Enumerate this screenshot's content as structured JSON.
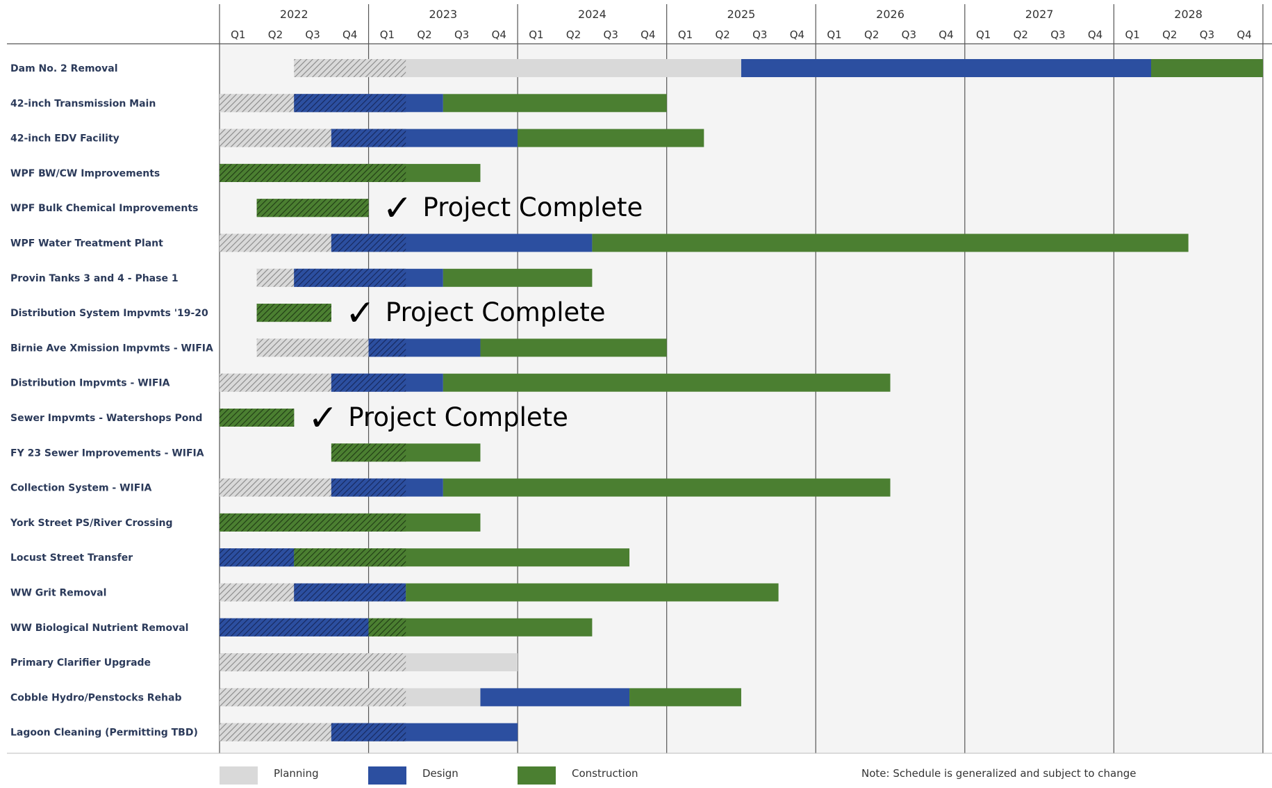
{
  "chart_data": {
    "type": "gantt",
    "years": [
      "2022",
      "2023",
      "2024",
      "2025",
      "2026",
      "2027",
      "2028"
    ],
    "quarters": [
      "Q1",
      "Q2",
      "Q3",
      "Q4"
    ],
    "phases": {
      "planning": {
        "label": "Planning",
        "color": "#d9d9d9",
        "hatch_color": "#888888"
      },
      "design": {
        "label": "Design",
        "color": "#2c4fa0",
        "hatch_color": "#16275a"
      },
      "construction": {
        "label": "Construction",
        "color": "#4b7f31",
        "hatch_color": "#1f3a14"
      }
    },
    "hatch_end": "2023-Q2",
    "note": "Note: Schedule is generalized and subject to change",
    "complete_text": "Project Complete",
    "rows": [
      {
        "label": "Dam No. 2 Removal",
        "segments": [
          [
            "planning",
            "2022-Q3",
            "2025-Q3"
          ],
          [
            "design",
            "2025-Q3",
            "2028-Q2"
          ],
          [
            "construction",
            "2028-Q2",
            "2029-Q1"
          ]
        ]
      },
      {
        "label": "42-inch Transmission Main",
        "segments": [
          [
            "planning",
            "2022-Q1",
            "2022-Q3"
          ],
          [
            "design",
            "2022-Q3",
            "2023-Q3"
          ],
          [
            "construction",
            "2023-Q3",
            "2025-Q1"
          ]
        ]
      },
      {
        "label": "42-inch EDV Facility",
        "segments": [
          [
            "planning",
            "2022-Q1",
            "2022-Q4"
          ],
          [
            "design",
            "2022-Q4",
            "2024-Q1"
          ],
          [
            "construction",
            "2024-Q1",
            "2025-Q2"
          ]
        ]
      },
      {
        "label": "WPF BW/CW Improvements",
        "segments": [
          [
            "construction",
            "2022-Q1",
            "2023-Q4"
          ]
        ]
      },
      {
        "label": "WPF Bulk Chemical Improvements",
        "segments": [
          [
            "construction",
            "2022-Q2",
            "2023-Q1"
          ]
        ],
        "complete": true
      },
      {
        "label": "WPF Water Treatment Plant",
        "segments": [
          [
            "planning",
            "2022-Q1",
            "2022-Q4"
          ],
          [
            "design",
            "2022-Q4",
            "2024-Q3"
          ],
          [
            "construction",
            "2024-Q3",
            "2028-Q3"
          ]
        ]
      },
      {
        "label": "Provin Tanks 3 and 4  - Phase 1",
        "segments": [
          [
            "planning",
            "2022-Q2",
            "2022-Q3"
          ],
          [
            "design",
            "2022-Q3",
            "2023-Q3"
          ],
          [
            "construction",
            "2023-Q3",
            "2024-Q3"
          ]
        ]
      },
      {
        "label": "Distribution System Impvmts '19-20",
        "segments": [
          [
            "construction",
            "2022-Q2",
            "2022-Q4"
          ]
        ],
        "complete": true
      },
      {
        "label": "Birnie Ave Xmission Impvmts - WIFIA",
        "segments": [
          [
            "planning",
            "2022-Q2",
            "2023-Q1"
          ],
          [
            "design",
            "2023-Q1",
            "2023-Q4"
          ],
          [
            "construction",
            "2023-Q4",
            "2025-Q1"
          ]
        ]
      },
      {
        "label": "Distribution Impvmts - WIFIA",
        "segments": [
          [
            "planning",
            "2022-Q1",
            "2022-Q4"
          ],
          [
            "design",
            "2022-Q4",
            "2023-Q3"
          ],
          [
            "construction",
            "2023-Q3",
            "2026-Q3"
          ]
        ]
      },
      {
        "label": "Sewer Impvmts - Watershops Pond",
        "segments": [
          [
            "construction",
            "2022-Q1",
            "2022-Q3"
          ]
        ],
        "complete": true
      },
      {
        "label": "FY 23 Sewer Improvements - WIFIA",
        "segments": [
          [
            "construction",
            "2022-Q4",
            "2023-Q4"
          ]
        ]
      },
      {
        "label": "Collection System - WIFIA",
        "segments": [
          [
            "planning",
            "2022-Q1",
            "2022-Q4"
          ],
          [
            "design",
            "2022-Q4",
            "2023-Q3"
          ],
          [
            "construction",
            "2023-Q3",
            "2026-Q3"
          ]
        ]
      },
      {
        "label": "York Street PS/River Crossing",
        "segments": [
          [
            "construction",
            "2022-Q1",
            "2023-Q4"
          ]
        ]
      },
      {
        "label": "Locust Street Transfer",
        "segments": [
          [
            "design",
            "2022-Q1",
            "2022-Q3"
          ],
          [
            "construction",
            "2022-Q3",
            "2024-Q4"
          ]
        ]
      },
      {
        "label": "WW Grit Removal",
        "segments": [
          [
            "planning",
            "2022-Q1",
            "2022-Q3"
          ],
          [
            "design",
            "2022-Q3",
            "2023-Q2"
          ],
          [
            "construction",
            "2023-Q2",
            "2025-Q4"
          ]
        ]
      },
      {
        "label": "WW Biological Nutrient Removal",
        "segments": [
          [
            "design",
            "2022-Q1",
            "2023-Q1"
          ],
          [
            "construction",
            "2023-Q1",
            "2024-Q3"
          ]
        ]
      },
      {
        "label": "Primary Clarifier Upgrade",
        "segments": [
          [
            "planning",
            "2022-Q1",
            "2024-Q1"
          ]
        ]
      },
      {
        "label": "Cobble Hydro/Penstocks Rehab",
        "segments": [
          [
            "planning",
            "2022-Q1",
            "2023-Q4"
          ],
          [
            "design",
            "2023-Q4",
            "2024-Q4"
          ],
          [
            "construction",
            "2024-Q4",
            "2025-Q3"
          ]
        ]
      },
      {
        "label": "Lagoon Cleaning (Permitting TBD)",
        "segments": [
          [
            "planning",
            "2022-Q1",
            "2022-Q4"
          ],
          [
            "design",
            "2022-Q4",
            "2024-Q1"
          ]
        ]
      }
    ]
  }
}
